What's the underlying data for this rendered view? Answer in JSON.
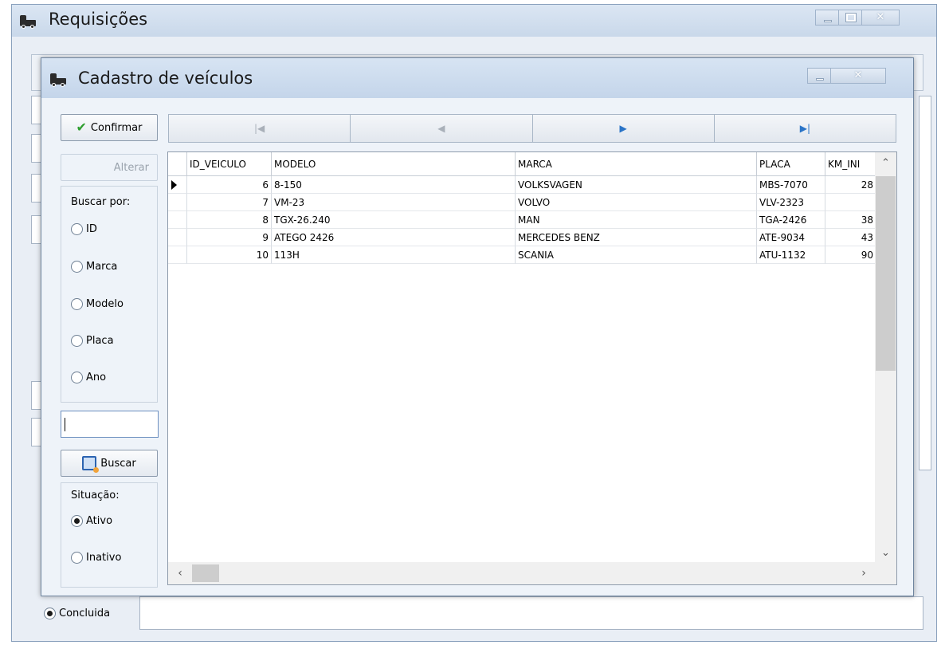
{
  "outer_window": {
    "title": "Requisições",
    "radio_concluida": "Concluida"
  },
  "dialog": {
    "title": "Cadastro de veículos",
    "buttons": {
      "confirmar": "Confirmar",
      "alterar": "Alterar",
      "buscar": "Buscar"
    },
    "search": {
      "label": "Buscar por:",
      "options": [
        "ID",
        "Marca",
        "Modelo",
        "Placa",
        "Ano"
      ],
      "selected": "",
      "input_value": ""
    },
    "situacao": {
      "label": "Situação:",
      "options": [
        "Ativo",
        "Inativo"
      ],
      "selected": "Ativo"
    },
    "navigator": {
      "first": "first-record",
      "prior": "prior-record",
      "next": "next-record",
      "last": "last-record"
    },
    "grid": {
      "columns": [
        "ID_VEICULO",
        "MODELO",
        "MARCA",
        "PLACA",
        "KM_INI"
      ],
      "rows": [
        {
          "id": "6",
          "modelo": "8-150",
          "marca": "VOLKSVAGEN",
          "placa": "MBS-7070",
          "km": "28"
        },
        {
          "id": "7",
          "modelo": "VM-23",
          "marca": "VOLVO",
          "placa": "VLV-2323",
          "km": ""
        },
        {
          "id": "8",
          "modelo": "TGX-26.240",
          "marca": "MAN",
          "placa": "TGA-2426",
          "km": "38"
        },
        {
          "id": "9",
          "modelo": "ATEGO 2426",
          "marca": "MERCEDES BENZ",
          "placa": "ATE-9034",
          "km": "43"
        },
        {
          "id": "10",
          "modelo": "113H",
          "marca": "SCANIA",
          "placa": "ATU-1132",
          "km": "90"
        }
      ],
      "current_row": 0
    }
  },
  "colors": {
    "window_bg": "#e9eef5",
    "title_gradient_top": "#dbe6f3",
    "accent_blue": "#2a74c7",
    "check_green": "#2e9e2e"
  }
}
